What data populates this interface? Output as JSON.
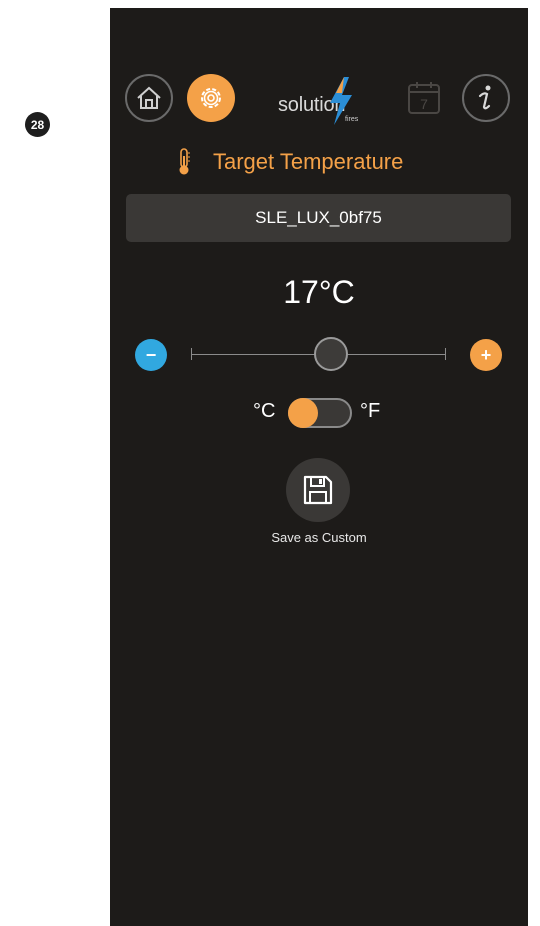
{
  "page_number": "28",
  "header": {
    "logo_text": "solution",
    "logo_subtext": "fires",
    "calendar_day": "7"
  },
  "title": "Target Temperature",
  "device_name": "SLE_LUX_0bf75",
  "temperature": {
    "value_label": "17°C",
    "value": 17,
    "unit": "C"
  },
  "slider": {
    "minus_label": "−",
    "plus_label": "+",
    "position_fraction": 0.55
  },
  "units": {
    "celsius_label": "°C",
    "fahrenheit_label": "°F",
    "selected": "celsius"
  },
  "save": {
    "label": "Save as Custom"
  },
  "colors": {
    "background": "#1d1b19",
    "accent": "#f4a148",
    "minus": "#31a8e0",
    "field": "#3a3836"
  },
  "icons": [
    "home-icon",
    "settings-gear-icon",
    "lightning-bolt-icon",
    "calendar-icon",
    "info-icon",
    "thermometer-icon",
    "floppy-disk-icon"
  ]
}
